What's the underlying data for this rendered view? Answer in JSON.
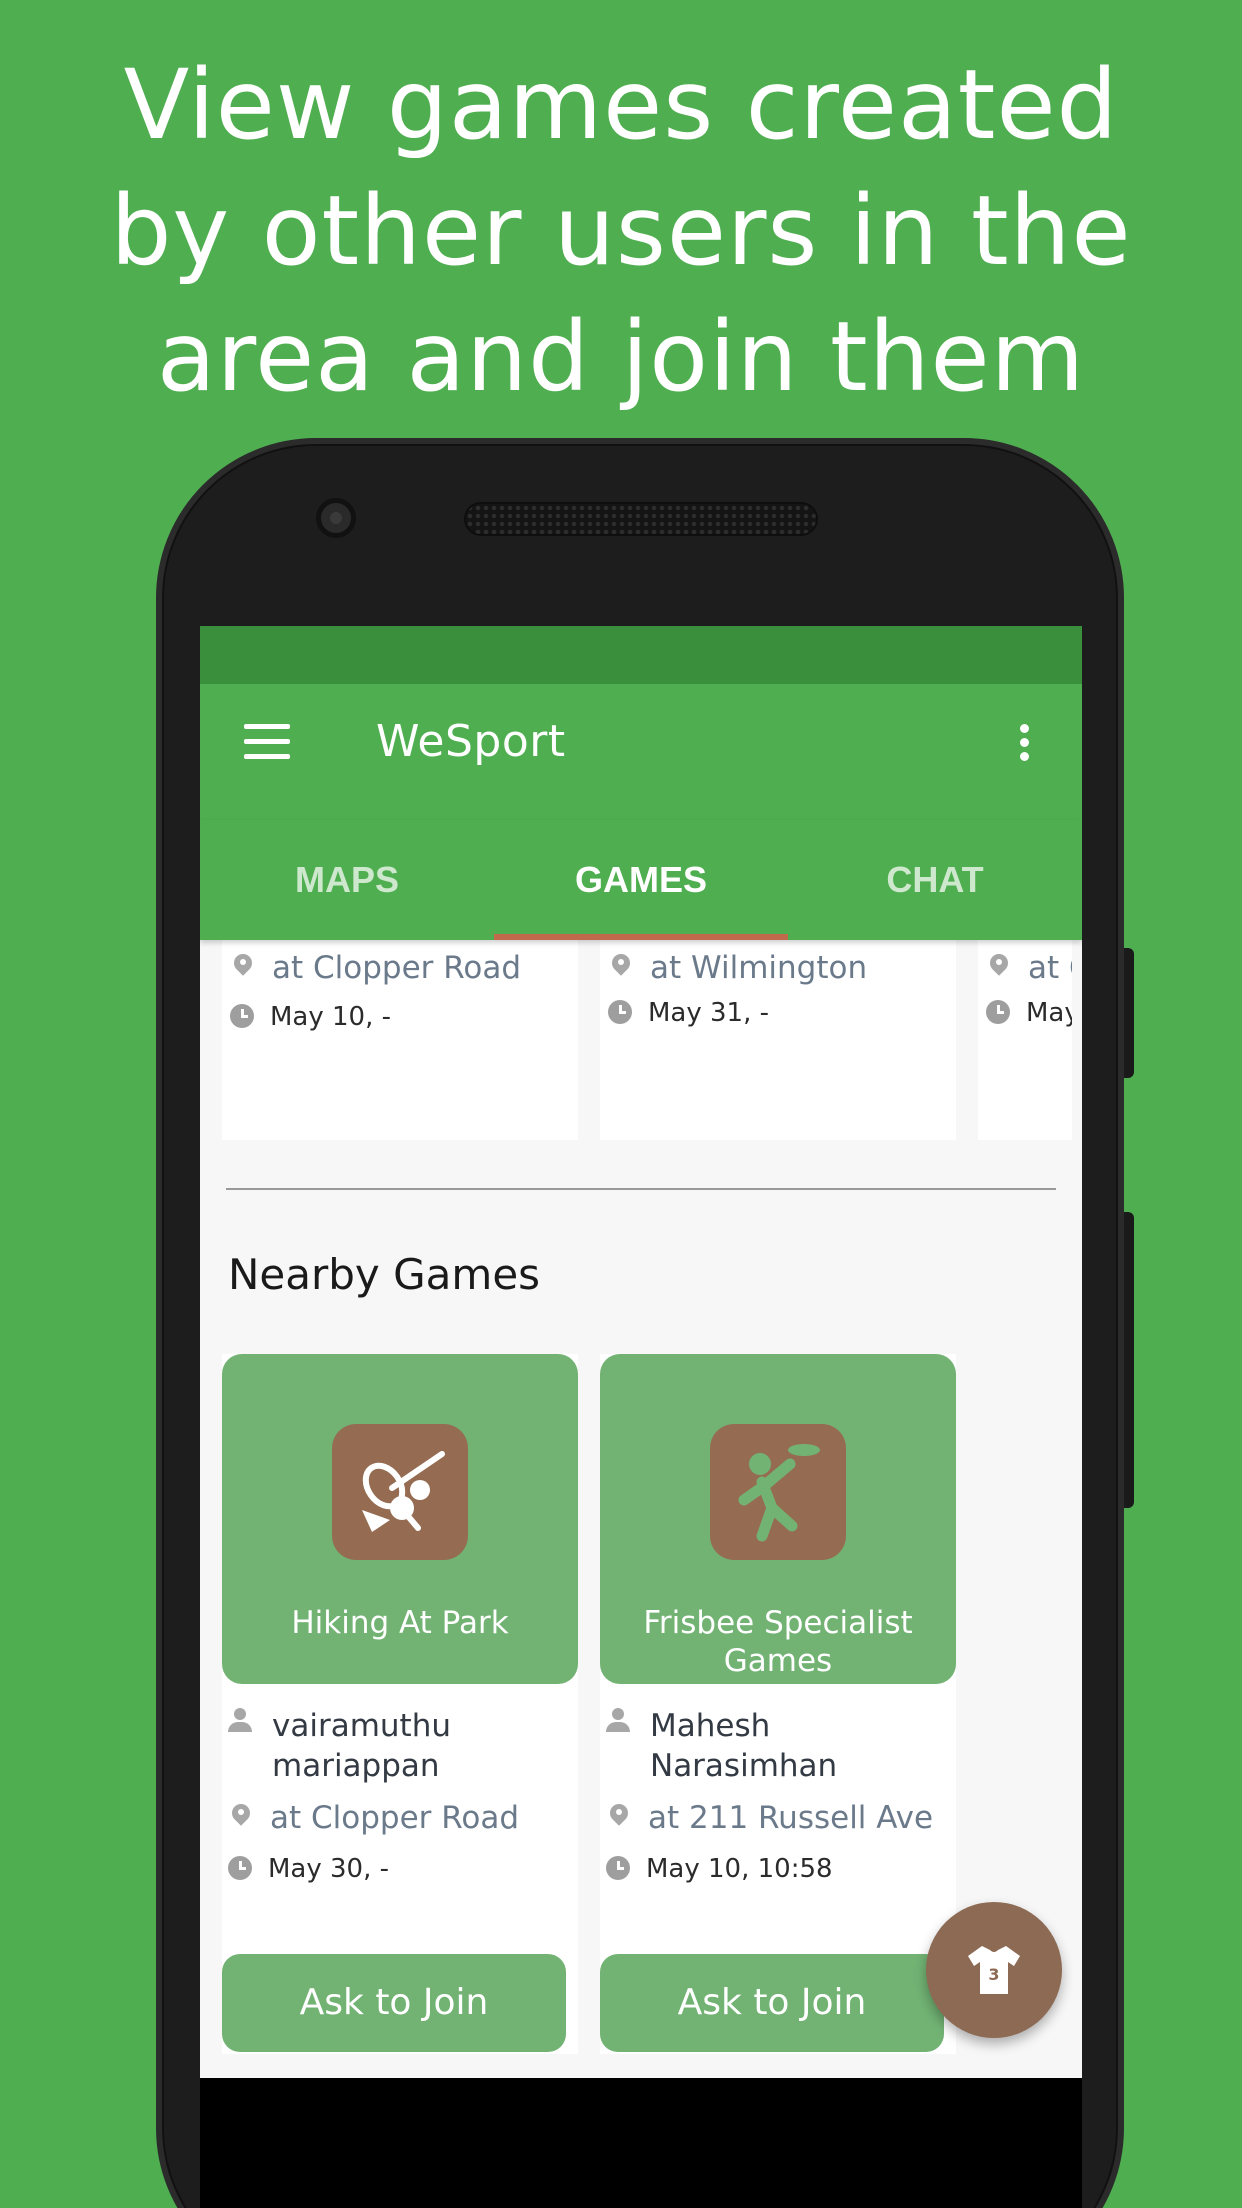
{
  "promo": {
    "lines": [
      "View games created",
      "by other users in the",
      "area and join them"
    ]
  },
  "appbar": {
    "title": "WeSport",
    "menu_icon": "hamburger-menu-icon",
    "more_icon": "more-vert-icon"
  },
  "tabs": [
    {
      "label": "MAPS",
      "active": false
    },
    {
      "label": "GAMES",
      "active": true
    },
    {
      "label": "CHAT",
      "active": false
    }
  ],
  "my_games": [
    {
      "location": "at Clopper Road",
      "date": "May 10, -"
    },
    {
      "location": "at Wilmington",
      "date": "May 31, -"
    },
    {
      "location": "at C",
      "date": "May"
    }
  ],
  "nearby": {
    "title": "Nearby Games",
    "games": [
      {
        "title": "Hiking At Park",
        "icon": "hiking-racket-icon",
        "organizer": "vairamuthu mariappan",
        "location": "at Clopper Road",
        "date": "May 30, -",
        "button": "Ask to Join"
      },
      {
        "title": "Frisbee Specialist Games",
        "icon": "frisbee-player-icon",
        "organizer": "Mahesh Narasimhan",
        "location": "at 211 Russell Ave",
        "date": "May 10, 10:58",
        "button": "Ask to Join"
      }
    ]
  },
  "fab": {
    "icon": "jersey-icon",
    "badge": "3"
  },
  "colors": {
    "primary": "#4fae50",
    "primary_dark": "#3a8f3c",
    "card_green": "#72b374",
    "accent": "#8d6a53",
    "tab_indicator": "#c0694d"
  }
}
